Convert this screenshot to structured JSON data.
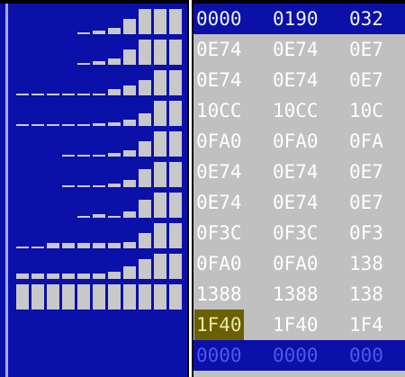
{
  "hex_table": {
    "header": [
      "0000",
      "0190",
      "032"
    ],
    "rows": [
      [
        "0E74",
        "0E74",
        "0E7"
      ],
      [
        "0E74",
        "0E74",
        "0E7"
      ],
      [
        "10CC",
        "10CC",
        "10C"
      ],
      [
        "0FA0",
        "0FA0",
        "0FA"
      ],
      [
        "0E74",
        "0E74",
        "0E7"
      ],
      [
        "0E74",
        "0E74",
        "0E7"
      ],
      [
        "0F3C",
        "0F3C",
        "0F3"
      ],
      [
        "0FA0",
        "0FA0",
        "138"
      ],
      [
        "1388",
        "1388",
        "138"
      ],
      [
        "1F40",
        "1F40",
        "1F4"
      ]
    ],
    "footer": [
      "0000",
      "0000",
      "000"
    ],
    "selected_cell": "1F40"
  },
  "meters": {
    "colors": {
      "background": "#0a10a8",
      "bar": "#c8c8c8"
    },
    "rows": [
      [
        0.0,
        0.0,
        0.0,
        0.0,
        0.05,
        0.15,
        0.25,
        0.6,
        1.0,
        1.0,
        1.0
      ],
      [
        0.0,
        0.0,
        0.0,
        0.0,
        0.05,
        0.15,
        0.25,
        0.6,
        1.0,
        1.0,
        1.0
      ],
      [
        0.05,
        0.05,
        0.05,
        0.05,
        0.05,
        0.05,
        0.25,
        0.4,
        0.6,
        1.0,
        1.0
      ],
      [
        0.05,
        0.05,
        0.05,
        0.05,
        0.05,
        0.1,
        0.15,
        0.25,
        0.5,
        1.0,
        1.0
      ],
      [
        0.0,
        0.0,
        0.0,
        0.05,
        0.05,
        0.05,
        0.15,
        0.25,
        0.6,
        1.0,
        1.0
      ],
      [
        0.0,
        0.0,
        0.0,
        0.05,
        0.05,
        0.05,
        0.15,
        0.3,
        0.7,
        1.0,
        1.0
      ],
      [
        0.0,
        0.0,
        0.0,
        0.0,
        0.05,
        0.15,
        0.05,
        0.25,
        0.7,
        1.0,
        1.0
      ],
      [
        0.05,
        0.05,
        0.2,
        0.2,
        0.2,
        0.2,
        0.2,
        0.25,
        0.6,
        1.0,
        1.0
      ],
      [
        0.2,
        0.2,
        0.2,
        0.2,
        0.2,
        0.2,
        0.3,
        0.5,
        0.8,
        1.0,
        1.0
      ],
      [
        1.0,
        1.0,
        1.0,
        1.0,
        1.0,
        1.0,
        1.0,
        1.0,
        1.0,
        1.0,
        1.0
      ]
    ]
  }
}
